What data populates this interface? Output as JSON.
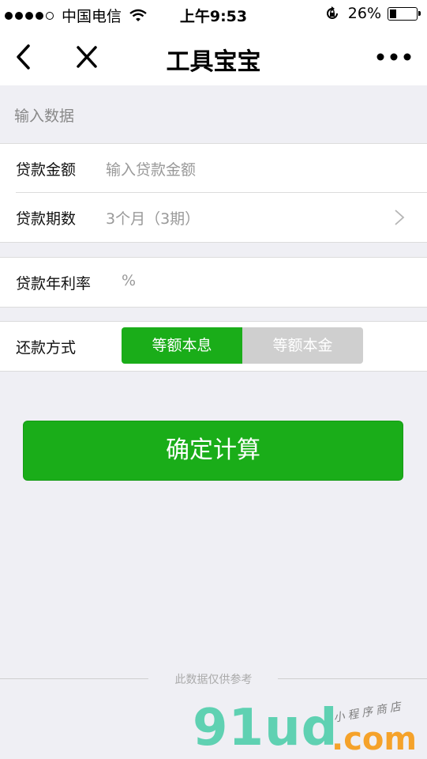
{
  "status_bar": {
    "carrier": "中国电信",
    "time": "上午9:53",
    "battery": "26%",
    "battery_level": 0.26,
    "signal_bars": 4,
    "icons": [
      "signal-icon",
      "wifi-icon",
      "orientation-lock-icon",
      "battery-icon"
    ]
  },
  "nav": {
    "title": "工具宝宝",
    "icons": [
      "back-icon",
      "close-icon",
      "more-icon"
    ]
  },
  "section": {
    "header": "输入数据"
  },
  "form": {
    "loan_amount": {
      "label": "贷款金额",
      "placeholder": "输入贷款金额"
    },
    "loan_term": {
      "label": "贷款期数",
      "value": "3个月（3期）"
    },
    "interest_rate": {
      "label": "贷款年利率",
      "unit": "%"
    },
    "repayment": {
      "label": "还款方式",
      "options": [
        "等额本息",
        "等额本金"
      ],
      "selected": "等额本息"
    }
  },
  "actions": {
    "calculate": "确定计算"
  },
  "footer": {
    "note": "此数据仅供参考"
  },
  "watermark": {
    "main": "91ud",
    "suffix": ".com",
    "tagline": "小程序商店"
  },
  "colors": {
    "accent": "#1aad19",
    "background": "#efeff4",
    "watermark_green": "#5fd1b2",
    "watermark_orange": "#f5a22a"
  }
}
